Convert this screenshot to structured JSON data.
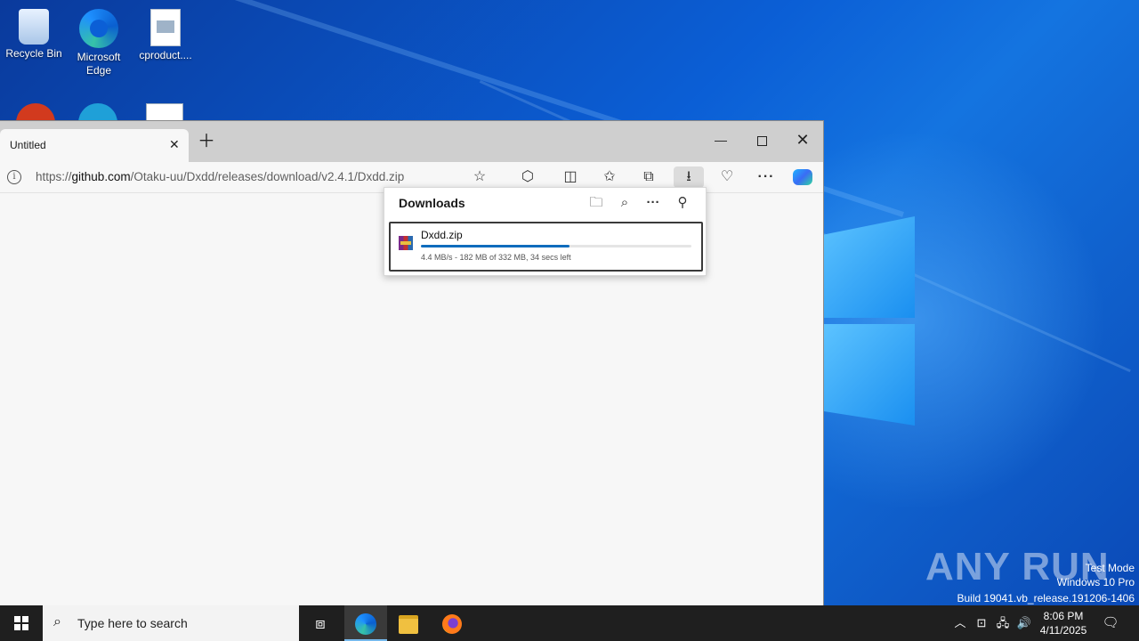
{
  "desktop": {
    "icons": [
      {
        "label": "Recycle Bin"
      },
      {
        "label": "Microsoft Edge"
      },
      {
        "label": "cproduct...."
      }
    ],
    "watermark": {
      "logo": "ANY RUN",
      "line1": "Test Mode",
      "line2": "Windows 10 Pro",
      "line3": "Build 19041.vb_release.191206-1406"
    }
  },
  "browser": {
    "tab_title": "Untitled",
    "url_prefix": "https://",
    "url_domain": "github.com",
    "url_path": "/Otaku-uu/Dxdd/releases/download/v2.4.1/Dxdd.zip",
    "downloads": {
      "title": "Downloads",
      "item": {
        "name": "Dxdd.zip",
        "status": "4.4 MB/s - 182 MB of 332 MB, 34 secs left",
        "progress": 0.548
      }
    }
  },
  "taskbar": {
    "search_placeholder": "Type here to search",
    "time": "8:06 PM",
    "date": "4/11/2025"
  },
  "icons": [
    "recycle-bin-icon",
    "edge-icon",
    "document-icon",
    "info-icon",
    "star-icon",
    "extensions-icon",
    "split-screen-icon",
    "favorites-icon",
    "collections-icon",
    "download-icon",
    "performance-icon",
    "more-icon",
    "copilot-icon",
    "folder-icon",
    "search-icon",
    "pin-icon",
    "archive-icon",
    "windows-icon",
    "task-view-icon",
    "file-explorer-icon",
    "firefox-icon",
    "chevron-up-icon",
    "network-icon",
    "volume-icon",
    "notification-icon"
  ]
}
